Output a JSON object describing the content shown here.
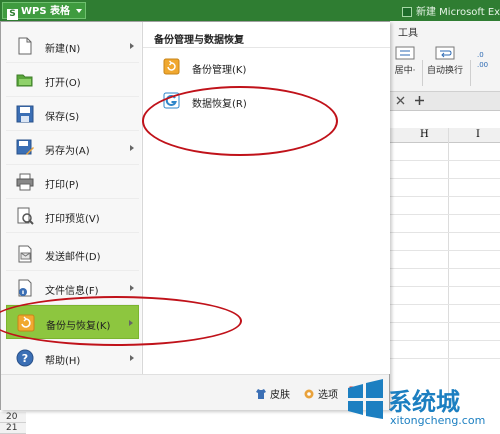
{
  "topbar": {
    "app_label": "WPS 表格",
    "doc_title": "新建 Microsoft Exce"
  },
  "ribbon": {
    "tools_tab": "工具",
    "btn_center": "居中·",
    "btn_wrap": "自动换行"
  },
  "sheet": {
    "column_h": "H",
    "column_i": "I",
    "rows": [
      "20",
      "21"
    ]
  },
  "menu": {
    "items": [
      {
        "label": "新建(N)",
        "icon": "new-doc-icon",
        "has_sub": true
      },
      {
        "label": "打开(O)",
        "icon": "folder-open-icon",
        "has_sub": false
      },
      {
        "label": "保存(S)",
        "icon": "save-icon",
        "has_sub": false
      },
      {
        "label": "另存为(A)",
        "icon": "save-as-icon",
        "has_sub": true
      },
      {
        "label": "打印(P)",
        "icon": "printer-icon",
        "has_sub": false
      },
      {
        "label": "打印预览(V)",
        "icon": "print-preview-icon",
        "has_sub": false
      },
      {
        "label": "发送邮件(D)",
        "icon": "mail-icon",
        "has_sub": false
      },
      {
        "label": "文件信息(F)",
        "icon": "file-info-icon",
        "has_sub": true
      },
      {
        "label": "备份与恢复(K)",
        "icon": "backup-icon",
        "has_sub": true
      },
      {
        "label": "帮助(H)",
        "icon": "help-icon",
        "has_sub": true
      }
    ],
    "panel": {
      "title": "备份管理与数据恢复",
      "items": [
        {
          "label": "备份管理(K)",
          "icon": "backup-manage-icon"
        },
        {
          "label": "数据恢复(R)",
          "icon": "data-recovery-icon"
        }
      ]
    },
    "footer": {
      "skin": "皮肤",
      "options": "选项"
    }
  },
  "watermark": {
    "text": "系统城",
    "url": "xitongcheng.com"
  },
  "colors": {
    "topbar": "#2f7d32",
    "active_item": "#8dc63f",
    "annotation": "#c0121a",
    "watermark": "#1c7fc1"
  }
}
